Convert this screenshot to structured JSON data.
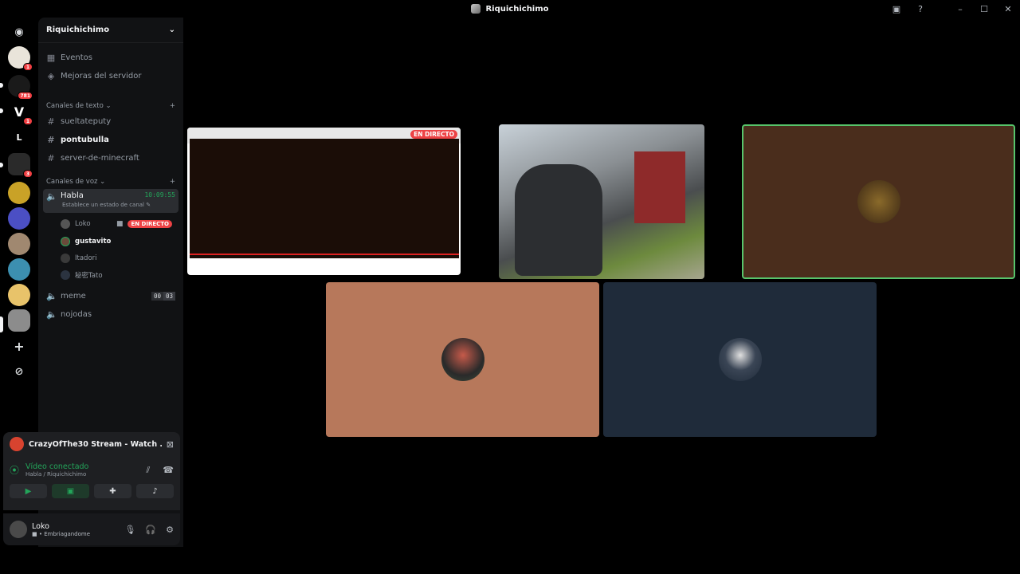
{
  "window": {
    "title": "Riquichichimo"
  },
  "rail": {
    "badges": [
      "1",
      "781",
      "1",
      "3"
    ],
    "letter_server": "L"
  },
  "sidebar": {
    "server_name": "Riquichichimo",
    "top_items": [
      "Eventos",
      "Mejoras del servidor"
    ],
    "text_category": "Canales de texto",
    "text_channels": [
      "sueltateputy",
      "pontubulla",
      "server-de-minecraft"
    ],
    "voice_category": "Canales de voz",
    "active_voice": {
      "name": "Habla",
      "timer": "10:09:55",
      "status_prompt": "Establece un estado de canal",
      "members": [
        "Loko",
        "gustavito",
        "Itadori",
        "秘密Tato"
      ],
      "live_label": "EN DIRECTO"
    },
    "other_voice": [
      {
        "name": "meme",
        "count_a": "00",
        "count_b": "03"
      },
      {
        "name": "nojodas"
      }
    ]
  },
  "stream_panel": {
    "title": "CrazyOfThe30 Stream - Watch ..."
  },
  "voice_panel": {
    "status": "Vídeo conectado",
    "location": "Habla / Riquichichimo"
  },
  "user_panel": {
    "name": "Loko",
    "status": "Embriagandome"
  },
  "stage": {
    "live_label": "EN DIRECTO"
  },
  "colors": {
    "tile_brown": "#4a2d1c",
    "tile_salmon": "#b7785b",
    "tile_navy": "#1f2b3a",
    "speaking_border": "#57c46b"
  }
}
